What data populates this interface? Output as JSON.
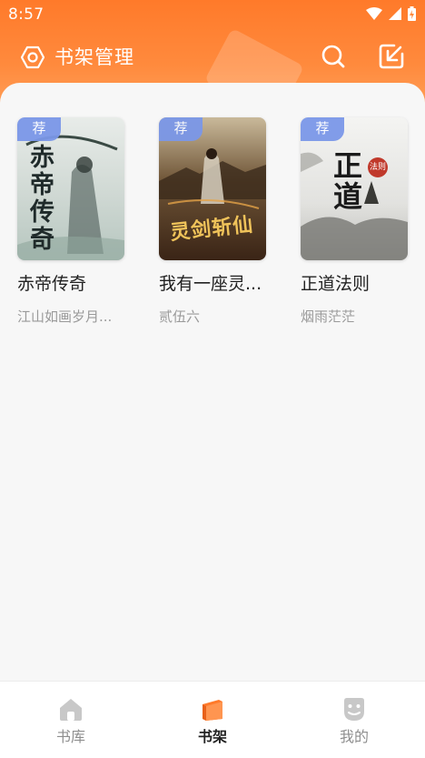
{
  "status_bar": {
    "time": "8:57"
  },
  "header": {
    "title": "书架管理"
  },
  "shelf": {
    "books": [
      {
        "badge": "荐",
        "title": "赤帝传奇",
        "author": "江山如画岁月...",
        "cover_title": "赤帝传奇"
      },
      {
        "badge": "荐",
        "title": "我有一座灵...",
        "author": "贰伍六",
        "cover_title": "灵剑斩仙"
      },
      {
        "badge": "荐",
        "title": "正道法则",
        "author": "烟雨茫茫",
        "cover_title": "正道",
        "cover_seal": "法则"
      }
    ]
  },
  "nav": {
    "items": [
      {
        "label": "书库",
        "icon": "home-icon"
      },
      {
        "label": "书架",
        "icon": "bookshelf-icon"
      },
      {
        "label": "我的",
        "icon": "profile-icon"
      }
    ],
    "active_index": 1
  },
  "colors": {
    "accent": "#ff7a2a",
    "badge": "#7b97e8",
    "nav_active_icon": "#ff7a2a",
    "nav_inactive_icon": "#c8c8c8"
  }
}
